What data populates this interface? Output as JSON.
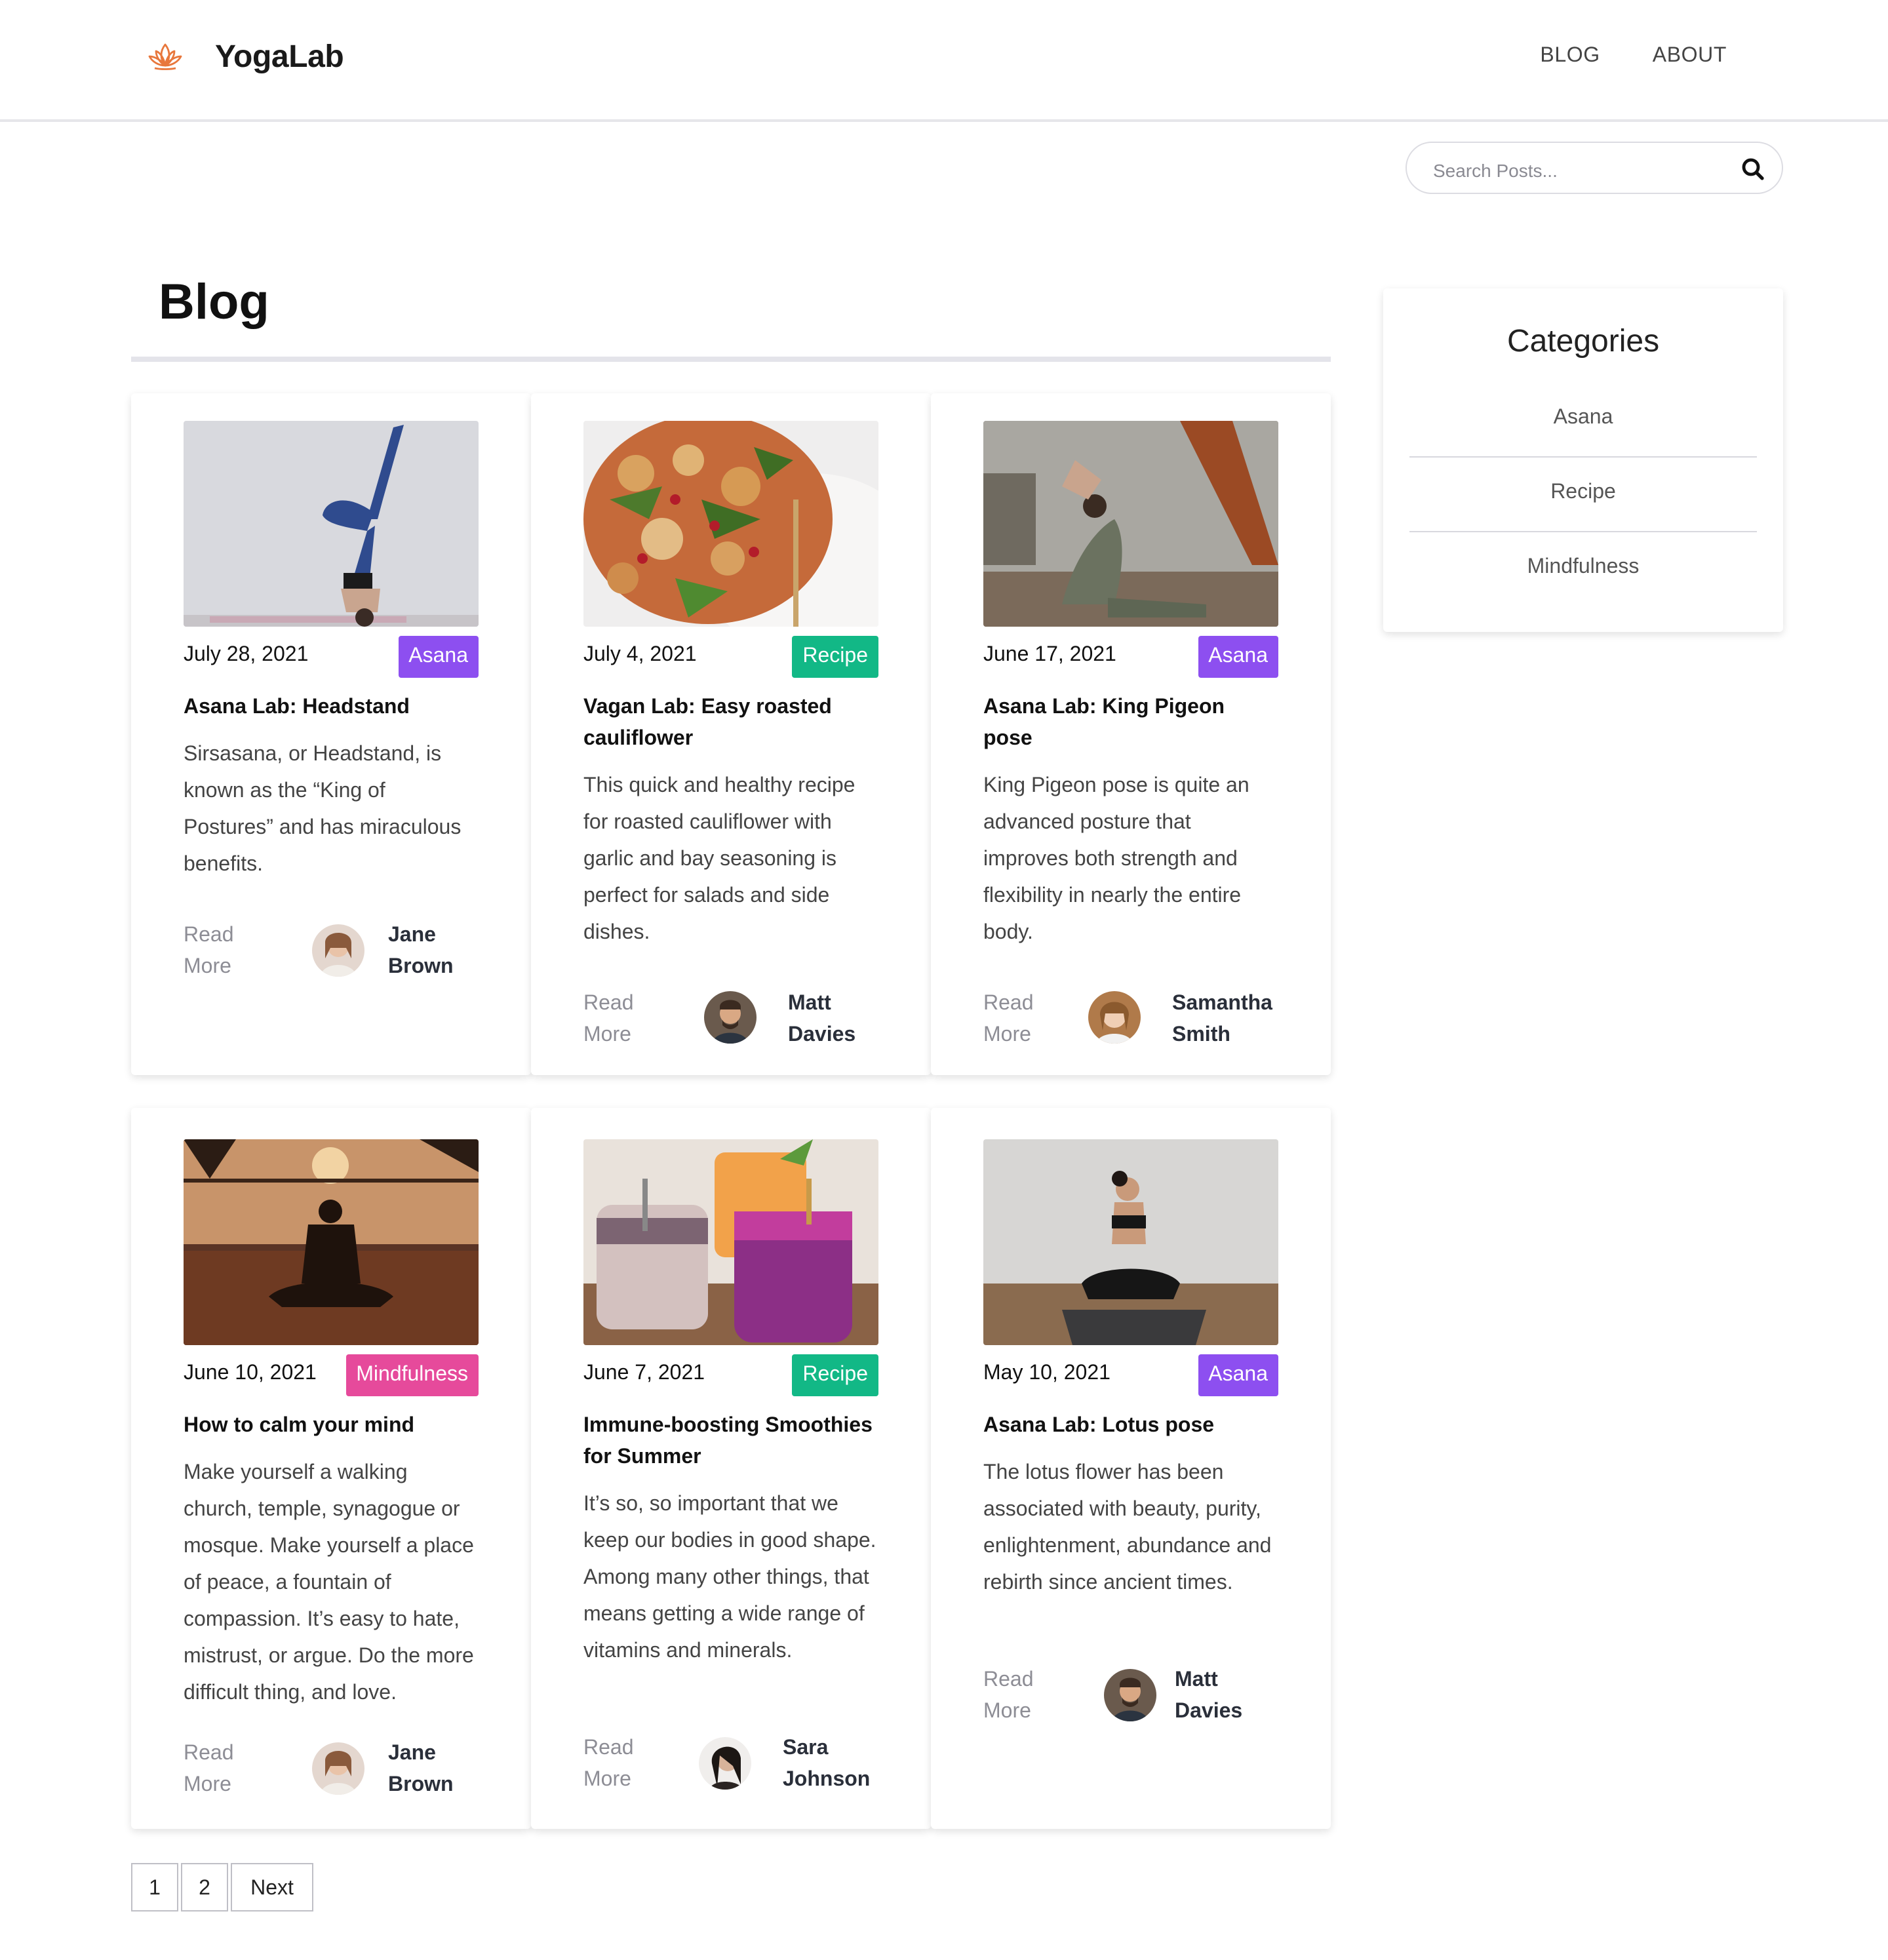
{
  "brand": {
    "name": "YogaLab",
    "logo_icon": "lotus-icon",
    "accent": "#e8773c"
  },
  "nav": {
    "items": [
      {
        "label": "BLOG"
      },
      {
        "label": "ABOUT"
      }
    ]
  },
  "search": {
    "placeholder": "Search Posts...",
    "icon": "search-icon"
  },
  "blog": {
    "title": "Blog"
  },
  "sidebar": {
    "title": "Categories",
    "categories": [
      {
        "label": "Asana"
      },
      {
        "label": "Recipe"
      },
      {
        "label": "Mindfulness"
      }
    ]
  },
  "category_colors": {
    "Asana": "#8d4ff0",
    "Recipe": "#12b886",
    "Mindfulness": "#e64a9b"
  },
  "posts": [
    {
      "date": "July 28, 2021",
      "category": "Asana",
      "title": "Asana Lab: Headstand",
      "excerpt": "Sirsasana, or Headstand, is known as the “King of Postures” and has miraculous benefits.",
      "read_more": "Read More",
      "author_first": "Jane",
      "author_last": "Brown"
    },
    {
      "date": "July 4, 2021",
      "category": "Recipe",
      "title": "Vagan Lab: Easy roasted cauliflower",
      "excerpt": "This quick and healthy recipe for roasted cauliflower with garlic and bay seasoning is perfect for salads and side dishes.",
      "read_more": "Read More",
      "author_first": "Matt",
      "author_last": "Davies"
    },
    {
      "date": "June 17, 2021",
      "category": "Asana",
      "title": "Asana Lab: King Pigeon pose",
      "excerpt": "King Pigeon pose is quite an advanced posture that improves both strength and flexibility in nearly the entire body.",
      "read_more": "Read More",
      "author_first": "Samantha",
      "author_last": "Smith"
    },
    {
      "date": "June 10, 2021",
      "category": "Mindfulness",
      "title": "How to calm your mind",
      "excerpt": "Make yourself a walking church, temple, synagogue or mosque. Make yourself a place of peace, a fountain of compassion. It’s easy to hate, mistrust, or argue. Do the more difficult thing, and love.",
      "read_more": "Read More",
      "author_first": "Jane",
      "author_last": "Brown"
    },
    {
      "date": "June 7, 2021",
      "category": "Recipe",
      "title": "Immune-boosting Smoothies for Summer",
      "excerpt": "It’s so, so important that we keep our bodies in good shape. Among many other things, that means getting a wide range of vitamins and minerals.",
      "read_more": "Read More",
      "author_first": "Sara",
      "author_last": "Johnson"
    },
    {
      "date": "May 10, 2021",
      "category": "Asana",
      "title": "Asana Lab: Lotus pose",
      "excerpt": "The lotus flower has been associated with beauty, purity, enlightenment, abundance and rebirth since ancient times.",
      "read_more": "Read More",
      "author_first": "Matt",
      "author_last": "Davies"
    }
  ],
  "pagination": {
    "pages": [
      "1",
      "2"
    ],
    "next": "Next"
  }
}
